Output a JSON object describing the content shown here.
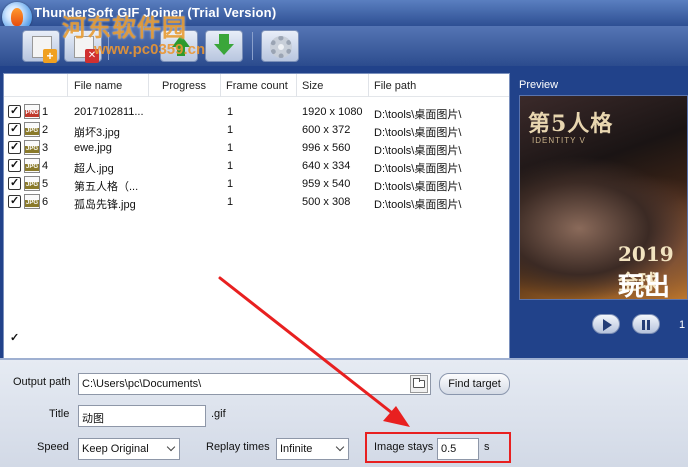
{
  "window": {
    "title": "ThunderSoft GIF Joiner (Trial Version)"
  },
  "watermark": {
    "brand": "河东软件园",
    "url": "www.pc0359.cn"
  },
  "toolbar": {
    "buttons": [
      {
        "name": "add-file-button",
        "icon": "add-file-icon"
      },
      {
        "name": "remove-file-button",
        "icon": "remove-file-icon"
      },
      {
        "name": "move-up-button",
        "icon": "arrow-up-icon"
      },
      {
        "name": "move-down-button",
        "icon": "arrow-down-icon"
      },
      {
        "name": "settings-button",
        "icon": "gear-icon"
      }
    ]
  },
  "filelist": {
    "columns": {
      "file_name": "File name",
      "progress": "Progress",
      "frame_count": "Frame count",
      "size": "Size",
      "file_path": "File path"
    },
    "rows": [
      {
        "checked": true,
        "type": "PNG",
        "type_color": "#c0392b",
        "num": "1",
        "name": "2017102811...",
        "frames": "1",
        "size": "1920 x 1080",
        "path": "D:\\tools\\桌面图片\\"
      },
      {
        "checked": true,
        "type": "JPG",
        "type_color": "#8a7a2a",
        "num": "2",
        "name": "崩坏3.jpg",
        "frames": "1",
        "size": "600 x 372",
        "path": "D:\\tools\\桌面图片\\"
      },
      {
        "checked": true,
        "type": "JPG",
        "type_color": "#8a7a2a",
        "num": "3",
        "name": "ewe.jpg",
        "frames": "1",
        "size": "996 x 560",
        "path": "D:\\tools\\桌面图片\\"
      },
      {
        "checked": true,
        "type": "JPG",
        "type_color": "#8a7a2a",
        "num": "4",
        "name": "超人.jpg",
        "frames": "1",
        "size": "640 x 334",
        "path": "D:\\tools\\桌面图片\\"
      },
      {
        "checked": true,
        "type": "JPG",
        "type_color": "#8a7a2a",
        "num": "5",
        "name": "第五人格（...",
        "frames": "1",
        "size": "959 x 540",
        "path": "D:\\tools\\桌面图片\\"
      },
      {
        "checked": true,
        "type": "JPG",
        "type_color": "#8a7a2a",
        "num": "6",
        "name": "孤岛先锋.jpg",
        "frames": "1",
        "size": "500 x 308",
        "path": "D:\\tools\\桌面图片\\"
      }
    ],
    "check_all_label": "Check / Uncheck all"
  },
  "preview": {
    "label": "Preview",
    "image_title": "第5人格",
    "image_subtitle": "IDENTITY V",
    "image_year": "2019 全球",
    "image_slogan": "玩出",
    "frame_number": "1"
  },
  "settings": {
    "output_path_label": "Output path",
    "output_path_value": "C:\\Users\\pc\\Documents\\",
    "find_target_label": "Find target",
    "title_label": "Title",
    "title_value": "动图",
    "title_ext": ".gif",
    "speed_label": "Speed",
    "speed_value": "Keep Original",
    "replay_label": "Replay times",
    "replay_value": "Infinite",
    "image_stays_label": "Image stays",
    "image_stays_value": "0.5",
    "image_stays_unit": "s"
  },
  "colors": {
    "frame_blue": "#21428a",
    "highlight_red": "#e82020"
  }
}
